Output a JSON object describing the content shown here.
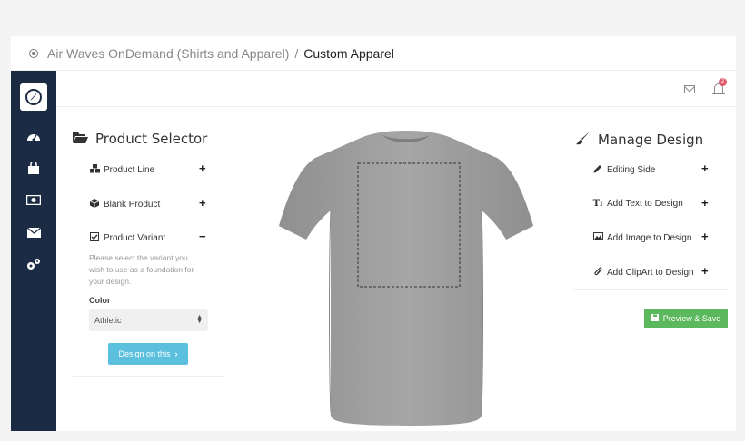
{
  "breadcrumb": {
    "parent": "Air Waves OnDemand (Shirts and Apparel)",
    "separator": "/",
    "current": "Custom Apparel"
  },
  "topbar": {
    "notification_count": "2"
  },
  "sidebar": {
    "items": [
      {
        "icon": "dashboard-icon"
      },
      {
        "icon": "shopping-bag-icon"
      },
      {
        "icon": "money-icon"
      },
      {
        "icon": "envelope-icon"
      },
      {
        "icon": "gears-icon"
      }
    ]
  },
  "product_selector": {
    "title": "Product Selector",
    "items": [
      {
        "label": "Product Line",
        "toggle": "+"
      },
      {
        "label": "Blank Product",
        "toggle": "+"
      },
      {
        "label": "Product Variant",
        "toggle": "−"
      }
    ],
    "help_text": "Please select the variant you wish to use as a foundation for your design.",
    "color_label": "Color",
    "color_value": "Athletic",
    "design_button": "Design on this"
  },
  "manage_design": {
    "title": "Manage Design",
    "items": [
      {
        "label": "Editing Side",
        "toggle": "+"
      },
      {
        "label": "Add Text to Design",
        "toggle": "+"
      },
      {
        "label": "Add Image to Design",
        "toggle": "+"
      },
      {
        "label": "Add ClipArt to Design",
        "toggle": "+"
      }
    ],
    "preview_button": "Preview & Save"
  },
  "colors": {
    "sidebar": "#1c2b44",
    "info_button": "#5bc0de",
    "success_button": "#5cb85c",
    "shirt": "#9e9e9e",
    "badge": "#e05a6d"
  }
}
